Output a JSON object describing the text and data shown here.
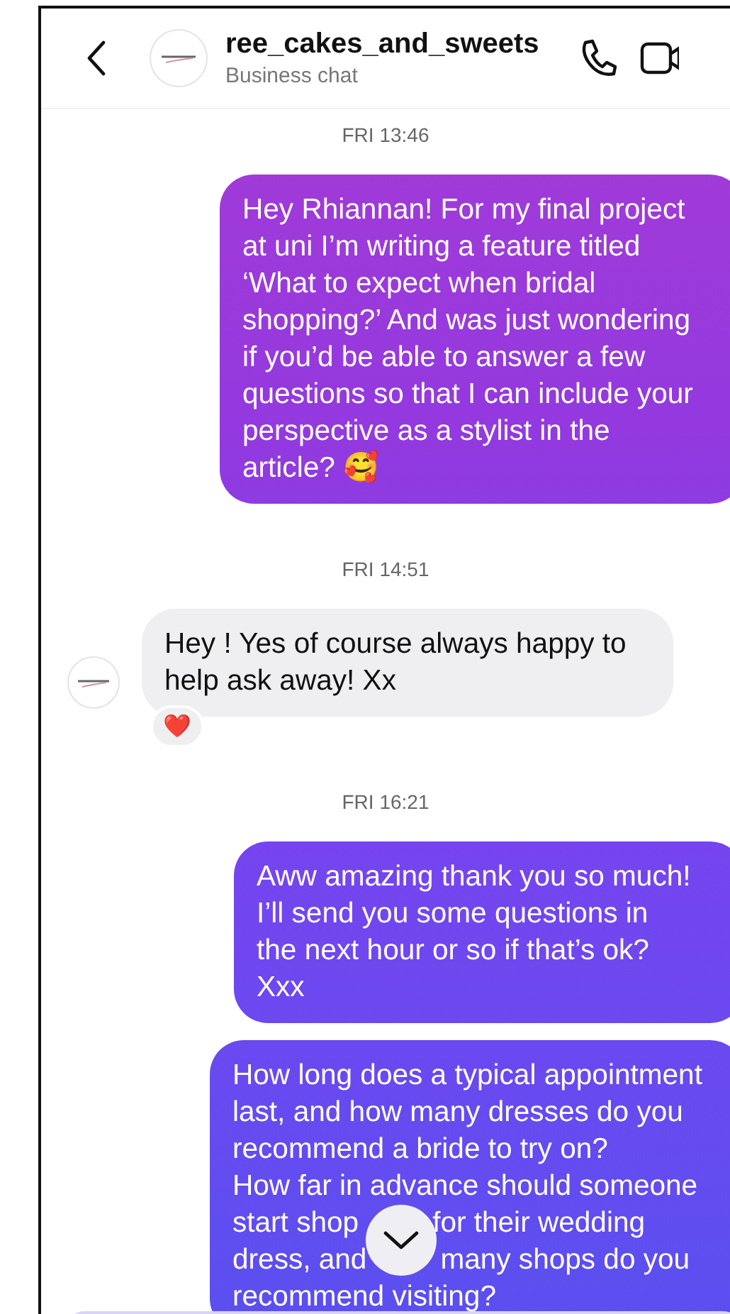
{
  "header": {
    "username": "ree_cakes_and_sweets",
    "subtitle": "Business chat"
  },
  "messages": [
    {
      "kind": "timestamp",
      "text": "FRI 13:46"
    },
    {
      "kind": "sent",
      "paragraphs": [
        "Hey Rhiannan! For my final project at uni I’m writing a feature titled ‘What to expect when bridal shopping?’ And was just wondering if you’d be able to answer a few questions so that I can include your perspective as a stylist in the article? 🥰"
      ]
    },
    {
      "kind": "timestamp",
      "text": "FRI 14:51"
    },
    {
      "kind": "received",
      "paragraphs": [
        "Hey ! Yes of course always happy to help ask away! Xx"
      ],
      "reaction": "❤️"
    },
    {
      "kind": "timestamp",
      "text": "FRI 16:21"
    },
    {
      "kind": "sent",
      "paragraphs": [
        "Aww amazing thank you so much! I’ll send you some questions in the next hour or so if that’s ok? Xxx"
      ]
    },
    {
      "kind": "sent",
      "paragraphs": [
        "How long does a typical appointment last, and how many dresses do you recommend a bride to try on?"
      ],
      "lines": [
        [
          "How far in advance should someone"
        ],
        [
          "start shop",
          "for their wedding"
        ],
        [
          "dress, and",
          "many shops do you"
        ],
        [
          "recommend visiting?"
        ]
      ]
    }
  ]
}
